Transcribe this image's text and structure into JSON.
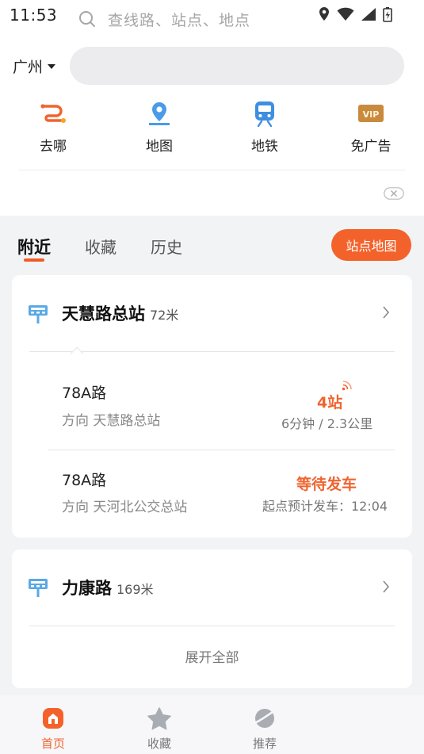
{
  "status_bar": {
    "time": "11:53"
  },
  "header": {
    "city": "广州",
    "search_placeholder": "查线路、站点、地点"
  },
  "quick_entries": [
    {
      "label": "去哪",
      "icon": "route-icon"
    },
    {
      "label": "地图",
      "icon": "map-pin-icon"
    },
    {
      "label": "地铁",
      "icon": "metro-icon"
    },
    {
      "label": "免广告",
      "icon": "vip-icon"
    }
  ],
  "tabs": [
    {
      "label": "附近",
      "active": true
    },
    {
      "label": "收藏",
      "active": false
    },
    {
      "label": "历史",
      "active": false
    }
  ],
  "station_map_button": "站点地图",
  "stops": [
    {
      "name": "天慧路总站",
      "distance": "72米",
      "routes": [
        {
          "name": "78A路",
          "direction": "方向 天慧路总站",
          "arrival": "4站",
          "detail": "6分钟 / 2.3公里"
        },
        {
          "name": "78A路",
          "direction": "方向 天河北公交总站",
          "arrival": "等待发车",
          "detail": "起点预计发车：12:04"
        }
      ]
    },
    {
      "name": "力康路",
      "distance": "169米",
      "expand_label": "展开全部"
    }
  ],
  "bottom_nav": [
    {
      "label": "首页",
      "icon": "home-icon",
      "active": true
    },
    {
      "label": "收藏",
      "icon": "star-icon",
      "active": false
    },
    {
      "label": "推荐",
      "icon": "planet-icon",
      "active": false
    }
  ],
  "colors": {
    "accent": "#f4622b",
    "highlight_text": "#f0642f",
    "bus_stop_icon": "#5aa9e6",
    "background": "#f2f3f5"
  }
}
